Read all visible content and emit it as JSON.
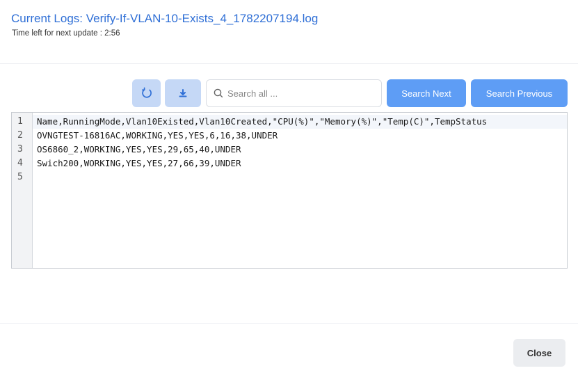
{
  "header": {
    "title": "Current Logs: Verify-If-VLAN-10-Exists_4_1782207194.log",
    "update_text": "Time left for next update : 2:56"
  },
  "toolbar": {
    "refresh_icon": "refresh-icon",
    "download_icon": "download-icon",
    "search_icon": "search-icon",
    "search_placeholder": "Search all ...",
    "search_value": "",
    "search_next_label": "Search Next",
    "search_previous_label": "Search Previous"
  },
  "editor": {
    "line_numbers": [
      "1",
      "2",
      "3",
      "4",
      "5"
    ],
    "lines": [
      "Name,RunningMode,Vlan10Existed,Vlan10Created,\"CPU(%)\",\"Memory(%)\",\"Temp(C)\",TempStatus",
      "OVNGTEST-16816AC,WORKING,YES,YES,6,16,38,UNDER",
      "OS6860_2,WORKING,YES,YES,29,65,40,UNDER",
      "Swich200,WORKING,YES,YES,27,66,39,UNDER",
      ""
    ]
  },
  "footer": {
    "close_label": "Close"
  },
  "colors": {
    "title": "#2f6fd6",
    "primary_button": "#5e9df5",
    "icon_button": "#c5d8f6",
    "close_button": "#ebedf0"
  }
}
